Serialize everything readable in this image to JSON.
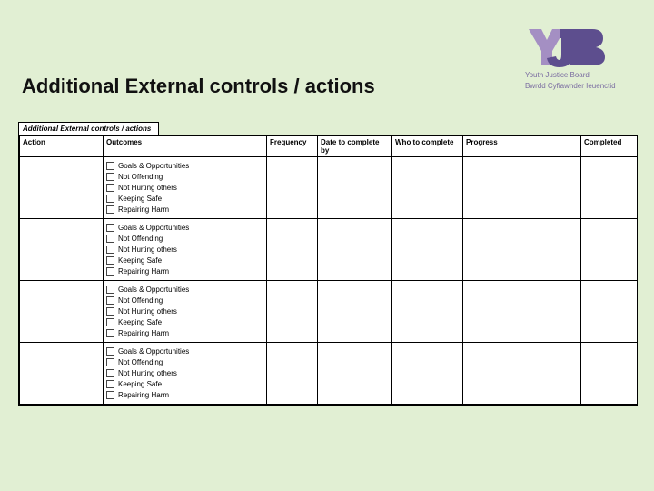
{
  "brand": {
    "name": "YJB",
    "full_en": "Youth Justice Board",
    "full_cy": "Bwrdd Cyfiawnder Ieuenctid",
    "color_primary": "#5d4e8e",
    "color_accent": "#a48fc3"
  },
  "title": "Additional External controls / actions",
  "form": {
    "section_title": "Additional External controls / actions",
    "columns": [
      "Action",
      "Outcomes",
      "Frequency",
      "Date to complete by",
      "Who to complete",
      "Progress",
      "Completed"
    ],
    "outcome_options": [
      "Goals & Opportunities",
      "Not Offending",
      "Not Hurting others",
      "Keeping Safe",
      "Repairing Harm"
    ],
    "rows": [
      {
        "action": "",
        "frequency": "",
        "date": "",
        "who": "",
        "progress": "",
        "completed": ""
      },
      {
        "action": "",
        "frequency": "",
        "date": "",
        "who": "",
        "progress": "",
        "completed": ""
      },
      {
        "action": "",
        "frequency": "",
        "date": "",
        "who": "",
        "progress": "",
        "completed": ""
      },
      {
        "action": "",
        "frequency": "",
        "date": "",
        "who": "",
        "progress": "",
        "completed": ""
      }
    ]
  }
}
